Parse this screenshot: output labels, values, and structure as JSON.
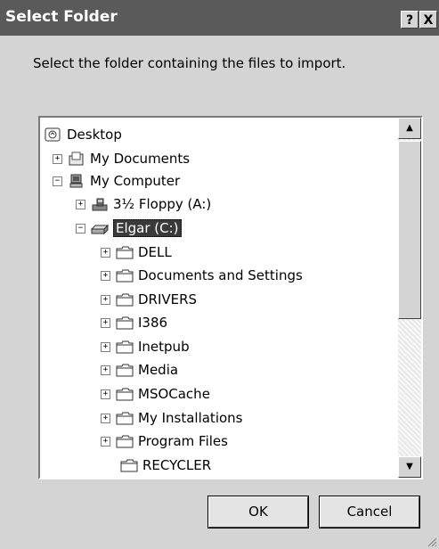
{
  "window": {
    "title": "Select Folder",
    "help_glyph": "?",
    "close_glyph": "X"
  },
  "instruction": "Select the folder containing the files to import.",
  "tree": {
    "items": [
      {
        "label": "Desktop",
        "icon": "desktop-icon",
        "expander": ""
      },
      {
        "label": "My Documents",
        "icon": "documents-icon",
        "expander": "+"
      },
      {
        "label": "My Computer",
        "icon": "computer-icon",
        "expander": "−"
      },
      {
        "label": "3½ Floppy (A:)",
        "icon": "floppy-icon",
        "expander": "+"
      },
      {
        "label": "Elgar (C:)",
        "icon": "hard-drive-icon",
        "expander": "−",
        "selected": true
      },
      {
        "label": "DELL",
        "icon": "folder-icon",
        "expander": "+"
      },
      {
        "label": "Documents and Settings",
        "icon": "folder-icon",
        "expander": "+"
      },
      {
        "label": "DRIVERS",
        "icon": "folder-icon",
        "expander": "+"
      },
      {
        "label": "I386",
        "icon": "folder-icon",
        "expander": "+"
      },
      {
        "label": "Inetpub",
        "icon": "folder-icon",
        "expander": "+"
      },
      {
        "label": "Media",
        "icon": "folder-icon",
        "expander": "+"
      },
      {
        "label": "MSOCache",
        "icon": "folder-icon",
        "expander": "+"
      },
      {
        "label": "My Installations",
        "icon": "folder-icon",
        "expander": "+"
      },
      {
        "label": "Program Files",
        "icon": "folder-icon",
        "expander": "+"
      },
      {
        "label": "RECYCLER",
        "icon": "folder-icon",
        "expander": ""
      }
    ]
  },
  "scrollbar": {
    "up": "▲",
    "down": "▼"
  },
  "buttons": {
    "ok": "OK",
    "cancel": "Cancel"
  }
}
